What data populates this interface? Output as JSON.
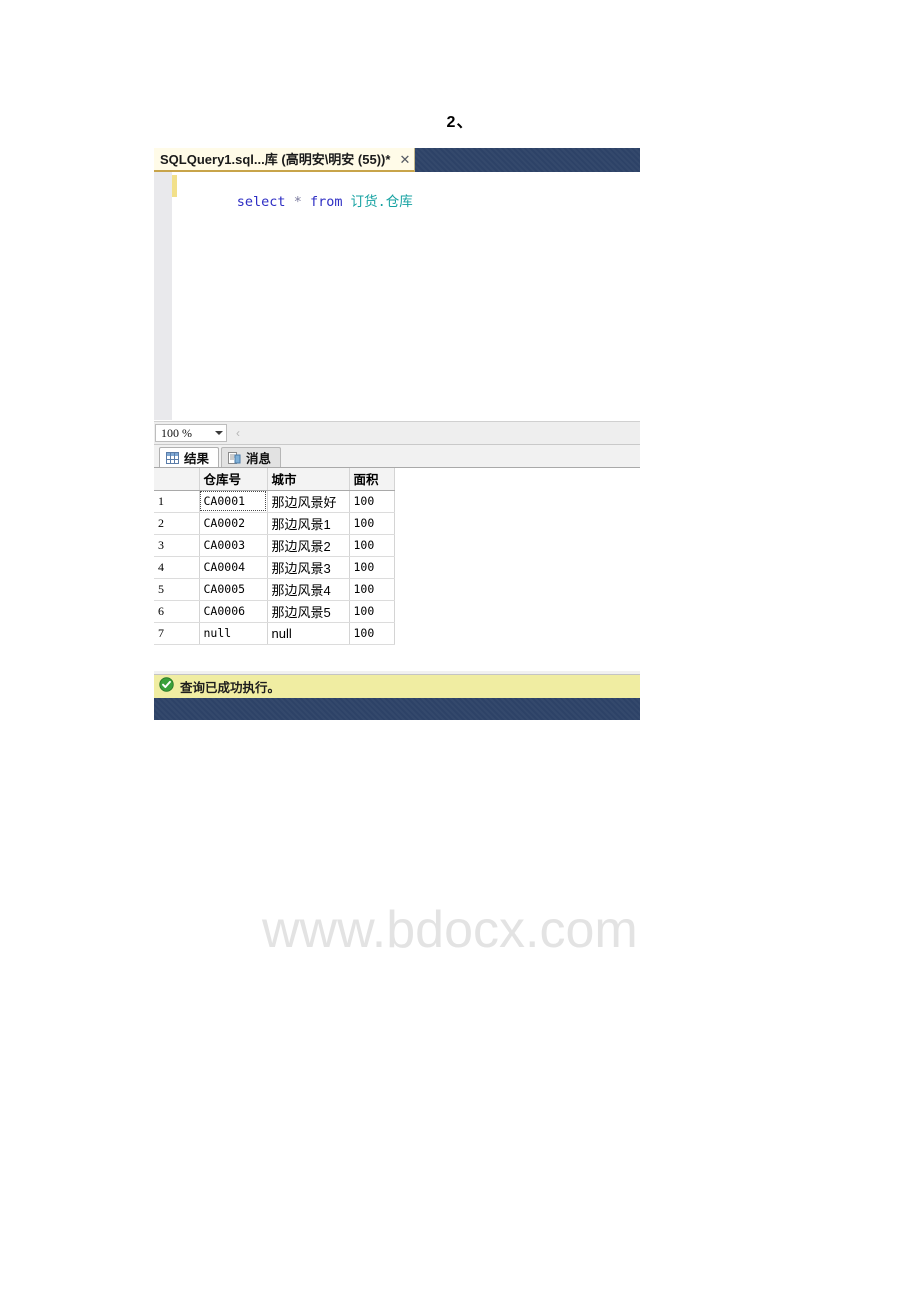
{
  "document": {
    "heading": "2、"
  },
  "editor_tab": {
    "title": "SQLQuery1.sql...库 (高明安\\明安 (55))*",
    "close_glyph": "✕",
    "close_icon_name": "close-icon"
  },
  "code": {
    "tokens": [
      {
        "text": "select",
        "type": "keyword"
      },
      {
        "text": " ",
        "type": "plain"
      },
      {
        "text": "*",
        "type": "operator"
      },
      {
        "text": " ",
        "type": "plain"
      },
      {
        "text": "from",
        "type": "keyword"
      },
      {
        "text": " ",
        "type": "plain"
      },
      {
        "text": "订货",
        "type": "identifier"
      },
      {
        "text": ".",
        "type": "punct"
      },
      {
        "text": "仓库",
        "type": "identifier"
      }
    ],
    "full_text": "select * from 订货.仓库"
  },
  "zoom_bar": {
    "value": "100 %",
    "nav_glyph": "‹"
  },
  "results_tabs": [
    {
      "label": "结果",
      "icon": "grid-icon",
      "active": true
    },
    {
      "label": "消息",
      "icon": "message-icon",
      "active": false
    }
  ],
  "grid": {
    "columns": [
      "",
      "仓库号",
      "城市",
      "面积"
    ],
    "rows": [
      {
        "num": "1",
        "仓库号": "CA0001",
        "城市": "那边风景好",
        "面积": "100",
        "selected": true
      },
      {
        "num": "2",
        "仓库号": "CA0002",
        "城市": "那边风景1",
        "面积": "100",
        "selected": false
      },
      {
        "num": "3",
        "仓库号": "CA0003",
        "城市": "那边风景2",
        "面积": "100",
        "selected": false
      },
      {
        "num": "4",
        "仓库号": "CA0004",
        "城市": "那边风景3",
        "面积": "100",
        "selected": false
      },
      {
        "num": "5",
        "仓库号": "CA0005",
        "城市": "那边风景4",
        "面积": "100",
        "selected": false
      },
      {
        "num": "6",
        "仓库号": "CA0006",
        "城市": "那边风景5",
        "面积": "100",
        "selected": false
      },
      {
        "num": "7",
        "仓库号": "null",
        "城市": "null",
        "面积": "100",
        "selected": false
      }
    ]
  },
  "status": {
    "message": "查询已成功执行。",
    "icon": "success-check-icon"
  },
  "watermark": {
    "text": "www.bdocx.com"
  },
  "colors": {
    "tab_strip_navy": "#2d4267",
    "active_tab_bg": "#fffbe8",
    "status_bar_yellow": "#f0eda2",
    "keyword_blue": "#2e2ec4",
    "identifier_teal": "#16a2a2",
    "success_green": "#3aa03a",
    "change_bar_yellow": "#f2e08a"
  }
}
